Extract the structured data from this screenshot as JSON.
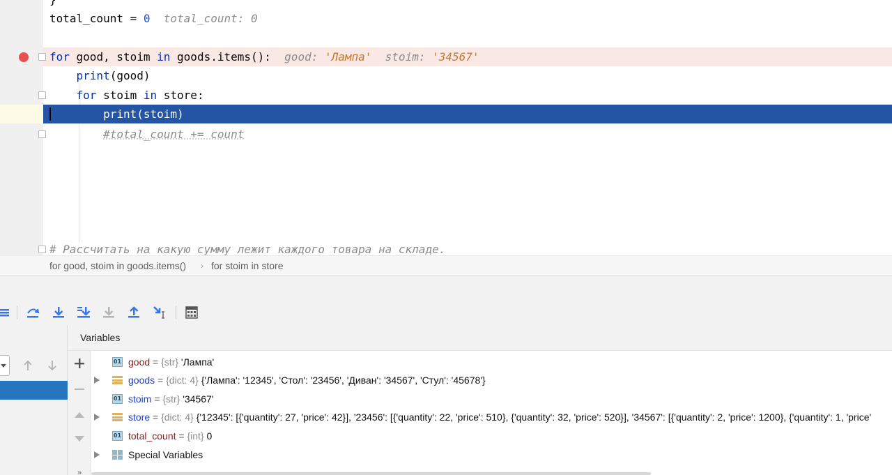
{
  "editor": {
    "lines": {
      "prev_brace": "}",
      "total_count": {
        "code_a": "total_count = ",
        "code_num": "0",
        "hint": "total_count: 0"
      },
      "for_goods": {
        "kw_for": "for",
        "code_a": " good, stoim ",
        "kw_in": "in",
        "code_b": " goods.items():",
        "hint_a": "good: ",
        "hint_a_val": "'Лампа'",
        "hint_b": "stoim: ",
        "hint_b_val": "'34567'"
      },
      "print_good": {
        "fn": "print",
        "code": "(good)"
      },
      "for_store": {
        "kw_for": "for",
        "code_a": " stoim ",
        "kw_in": "in",
        "code_b": " store:"
      },
      "print_stoim": {
        "fn": "print",
        "code": "(stoim)"
      },
      "comment_total": "#total_count += count",
      "comment_ru": "# Рассчитать на какую сумму лежит каждого товара на складе."
    }
  },
  "breadcrumb": {
    "items": [
      "for good, stoim in goods.items()",
      "for stoim in store"
    ],
    "separator": "›"
  },
  "toolbar": {
    "icons": [
      "show-execution-point-icon",
      "step-over-icon",
      "step-into-icon",
      "step-into-my-code-icon",
      "force-step-into-icon",
      "step-out-icon",
      "run-to-cursor-icon",
      "evaluate-expression-icon"
    ]
  },
  "variables": {
    "title": "Variables",
    "rows": [
      {
        "name": "good",
        "eq": " = ",
        "type": "{str}",
        "value": " 'Лампа'",
        "icon": "str-icon",
        "expandable": false
      },
      {
        "name": "goods",
        "eq": " = ",
        "type": "{dict: 4}",
        "value": " {'Лампа': '12345', 'Стол': '23456', 'Диван': '34567', 'Стул': '45678'}",
        "icon": "dict-icon",
        "expandable": true
      },
      {
        "name": "stoim",
        "eq": " = ",
        "type": "{str}",
        "value": " '34567'",
        "icon": "str-icon",
        "expandable": false
      },
      {
        "name": "store",
        "eq": " = ",
        "type": "{dict: 4}",
        "value": " {'12345': [{'quantity': 27, 'price': 42}], '23456': [{'quantity': 22, 'price': 510}, {'quantity': 32, 'price': 520}], '34567': [{'quantity': 2, 'price': 1200}, {'quantity': 1, 'price'",
        "icon": "dict-icon",
        "expandable": true
      },
      {
        "name": "total_count",
        "eq": " = ",
        "type": "{int}",
        "value": " 0",
        "icon": "int-icon",
        "expandable": false
      },
      {
        "name": "Special Variables",
        "eq": "",
        "type": "",
        "value": "",
        "icon": "special-variables-icon",
        "expandable": true
      }
    ]
  },
  "colors": {
    "execution_line": "#2454a4",
    "breakpoint_line": "#fae8e4",
    "breakpoint": "#e55252",
    "keyword": "#0033b3",
    "selected_frame": "#2675bf"
  }
}
